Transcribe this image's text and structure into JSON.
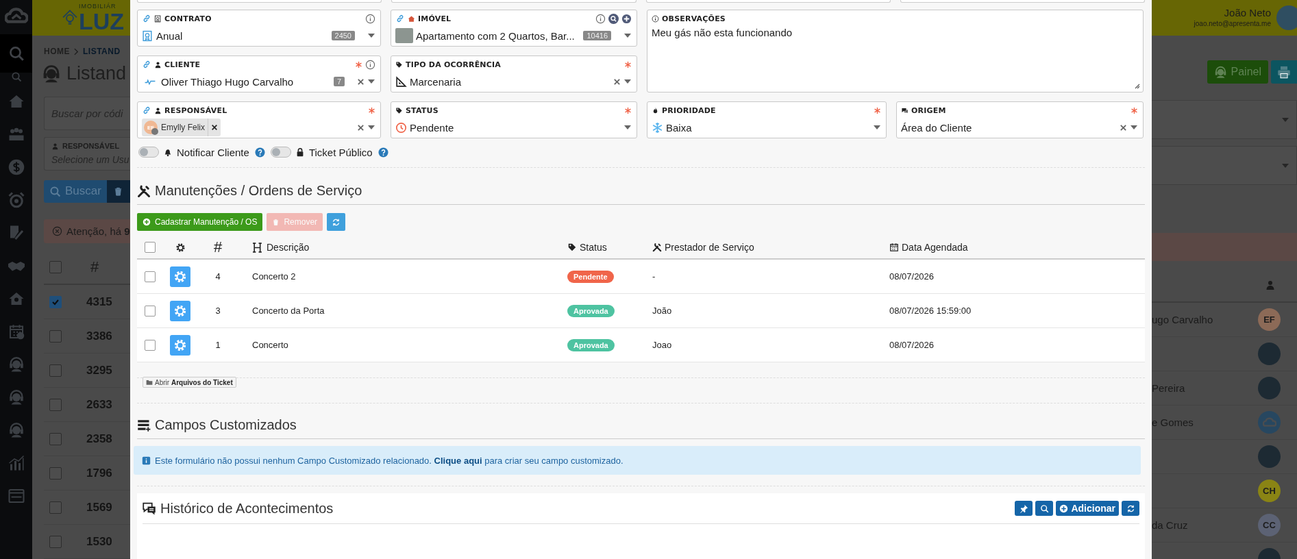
{
  "sidebar": {
    "items": [
      {
        "selected": true
      },
      {
        "selected": false
      },
      {
        "selected": false
      },
      {
        "selected": false
      },
      {
        "selected": false
      },
      {
        "selected": false
      },
      {
        "selected": false
      },
      {
        "selected": false
      },
      {
        "selected": false
      },
      {
        "selected": false
      },
      {
        "selected": false
      },
      {
        "selected": false
      },
      {
        "selected": false
      },
      {
        "selected": false
      },
      {
        "selected": false
      }
    ]
  },
  "background_page": {
    "header": {
      "logo_text": "LUZ",
      "logo_tagline": "IMOBILIÁR",
      "user_name": "João Neto",
      "user_email": "joao.neto@apresenta.me"
    },
    "breadcrumb": [
      {
        "label": "HOME"
      },
      {
        "label": "LISTAND"
      }
    ],
    "title": "Listand",
    "panel_button": "Painel",
    "search": {
      "placeholder": "Buscar por códi"
    },
    "filter": {
      "label": "RESPONSÁVEL",
      "placeholder": "Selecione um Usu"
    },
    "search_button": "Buscar",
    "alert": "Atenção, há **9**",
    "table": {
      "columns": [
        "#"
      ],
      "select_all_checked": false,
      "rows": [
        {
          "checked": true,
          "id": "4315",
          "column_right": "ugo Carvalho",
          "avatar": {
            "kind": "initials",
            "text": "EF",
            "color": "#8c6a57"
          }
        },
        {
          "checked": false,
          "id": "3386",
          "avatar": {
            "kind": "photo"
          }
        },
        {
          "checked": false,
          "id": "3295",
          "column_right": "Pereira",
          "avatar": {
            "kind": "photo"
          }
        },
        {
          "checked": false,
          "id": "2633",
          "column_right": "e Gomes",
          "avatar": {
            "kind": "logo",
            "color": "#274760"
          }
        },
        {
          "checked": false,
          "id": "2358",
          "avatar": {
            "kind": "photo"
          }
        },
        {
          "checked": false,
          "id": "1796",
          "avatar": {
            "kind": "initials",
            "text": "CH",
            "color": "#8a8414"
          }
        },
        {
          "checked": false,
          "id": "1569",
          "column_right": "da Cruz",
          "avatar": {
            "kind": "initials",
            "text": "CC",
            "color": "#5c6274"
          }
        },
        {
          "checked": false,
          "id": "1530",
          "avatar": {
            "kind": "photo"
          }
        }
      ]
    }
  },
  "modal": {
    "fields": [
      {
        "kind": "select",
        "label": "CONTRATO",
        "linked": true,
        "required": false,
        "info": true,
        "value": "Anual",
        "count": "2450",
        "clearable": false
      },
      {
        "kind": "select",
        "label": "IMÓVEL",
        "linked": true,
        "required": false,
        "info": true,
        "value": "Apartamento com 2 Quartos, Bar...",
        "count": "10416",
        "clearable": false
      },
      {
        "kind": "textarea",
        "label": "OBSERVAÇÕES",
        "linked": false,
        "required": false,
        "info": false,
        "value": "Meu gás não esta funcionando"
      },
      {
        "kind": "select",
        "label": "CLIENTE",
        "linked": true,
        "required": true,
        "info": true,
        "value": "Oliver Thiago Hugo Carvalho",
        "count": "7",
        "clearable": true
      },
      {
        "kind": "select",
        "label": "TIPO DA OCORRÊNCIA",
        "linked": false,
        "required": true,
        "info": false,
        "value": "Marcenaria",
        "clearable": true
      },
      {
        "kind": "tags",
        "label": "RESPONSÁVEL",
        "linked": true,
        "required": true,
        "info": false,
        "tags": [
          {
            "text": "Emylly Felix",
            "initials": "EF"
          }
        ],
        "clearable": true
      },
      {
        "kind": "select",
        "label": "STATUS",
        "linked": false,
        "required": true,
        "info": false,
        "value": "Pendente",
        "clearable": false
      },
      {
        "kind": "select",
        "label": "PRIORIDADE",
        "linked": false,
        "required": true,
        "info": false,
        "value": "Baixa",
        "clearable": false
      },
      {
        "kind": "select",
        "label": "ORIGEM",
        "linked": false,
        "required": true,
        "info": false,
        "value": "Área do Cliente",
        "clearable": true
      }
    ],
    "toggles": [
      {
        "label": "Notificar Cliente",
        "on": false
      },
      {
        "label": "Ticket Público",
        "on": false
      }
    ],
    "maintenance": {
      "title": "Manutenções / Ordens de Serviço",
      "buttons": [
        {
          "kind": "add",
          "label": "Cadastrar Manutenção / OS",
          "disabled": false
        },
        {
          "kind": "remove",
          "label": "Remover",
          "disabled": true
        },
        {
          "kind": "refresh",
          "disabled": false
        }
      ],
      "select_all_checked": false,
      "columns": [
        "#",
        "Descrição",
        "Status",
        "Prestador de Serviço",
        "Data Agendada"
      ],
      "rows": [
        {
          "checked": false,
          "number": "4",
          "description": "Concerto 2",
          "status": {
            "label": "Pendente",
            "color": "#f0654a"
          },
          "provider": "-",
          "date": "08/07/2026"
        },
        {
          "checked": false,
          "number": "3",
          "description": "Concerto da Porta",
          "status": {
            "label": "Aprovada",
            "color": "#4ec3a1"
          },
          "provider": "João",
          "date": "08/07/2026 15:59:00"
        },
        {
          "checked": false,
          "number": "1",
          "description": "Concerto",
          "status": {
            "label": "Aprovada",
            "color": "#4ec3a1"
          },
          "provider": "Joao",
          "date": "08/07/2026"
        }
      ]
    },
    "files_button": "Abrir **Arquivos do Ticket**",
    "custom_fields": {
      "title": "Campos Customizados",
      "info_before": "Este formulário não possui nenhum Campo Customizado relacionado.",
      "info_link": "Clique aqui",
      "info_after": "para criar seu campo customizado."
    },
    "history": {
      "title": "Histórico de Acontecimentos",
      "buttons": [
        {
          "kind": "pin"
        },
        {
          "kind": "search"
        },
        {
          "kind": "add",
          "label": "Adicionar"
        },
        {
          "kind": "refresh"
        }
      ]
    }
  }
}
